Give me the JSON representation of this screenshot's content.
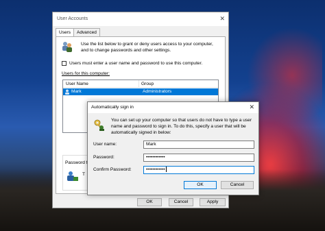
{
  "user_accounts": {
    "title": "User Accounts",
    "close_glyph": "✕",
    "tabs": [
      {
        "label": "Users"
      },
      {
        "label": "Advanced"
      }
    ],
    "intro": "Use the list below to grant or deny users access to your computer, and to change passwords and other settings.",
    "require_login_checkbox": "Users must enter a user name and password to use this computer.",
    "users_list_label": "Users for this computer:",
    "columns": [
      "User Name",
      "Group"
    ],
    "rows": [
      {
        "name": "Mark",
        "group": "Administrators"
      }
    ],
    "password_section_label": "Password fo",
    "password_section_text": "T",
    "buttons": {
      "ok": "OK",
      "cancel": "Cancel",
      "apply": "Apply"
    }
  },
  "dialog": {
    "title": "Automatically sign in",
    "close_glyph": "✕",
    "description": "You can set up your computer so that users do not have to type a user name and password to sign in. To do this, specify a user that will be automatically signed in below:",
    "fields": {
      "user_name_label": "User name:",
      "user_name_value": "Mark",
      "password_label": "Password:",
      "password_value": "••••••••••••",
      "confirm_label": "Confirm Password:",
      "confirm_value": "••••••••••••"
    },
    "buttons": {
      "ok": "OK",
      "cancel": "Cancel"
    }
  },
  "colors": {
    "selection": "#0078d7",
    "window_bg": "#f0f0f0"
  },
  "icons": [
    "users-icon",
    "key-icon",
    "user-password-icon",
    "close-icon"
  ]
}
